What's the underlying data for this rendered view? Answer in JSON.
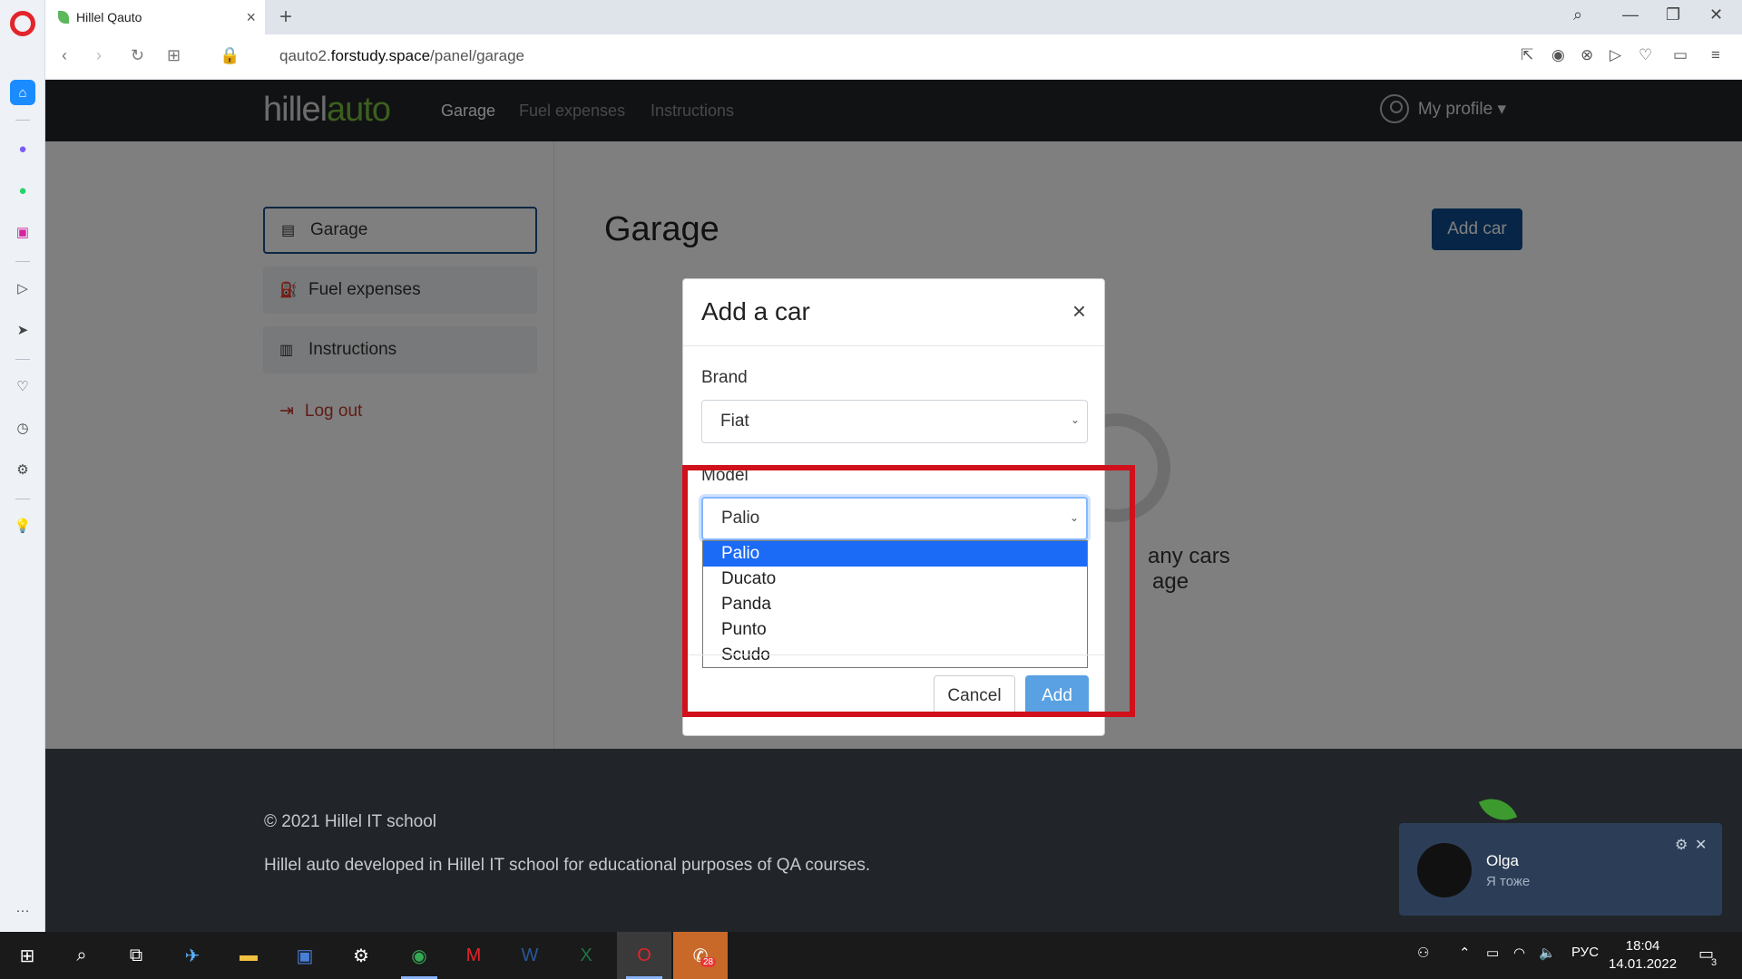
{
  "browser": {
    "tab_title": "Hillel Qauto",
    "new_tab": "+",
    "url_prefix": "qauto2.",
    "url_domain": "forstudy.space",
    "url_path": "/panel/garage"
  },
  "site": {
    "logo_part1": "hillel",
    "logo_part2": "auto",
    "nav": [
      "Garage",
      "Fuel expenses",
      "Instructions"
    ],
    "profile_label": "My profile ▾"
  },
  "sidebar": {
    "items": [
      {
        "label": "Garage"
      },
      {
        "label": "Fuel expenses"
      },
      {
        "label": "Instructions"
      }
    ],
    "logout": "Log out"
  },
  "main": {
    "title": "Garage",
    "add_car": "Add car",
    "empty_line1": "any cars",
    "empty_line2": "age"
  },
  "modal": {
    "title": "Add a car",
    "close": "×",
    "brand_label": "Brand",
    "brand_value": "Fiat",
    "model_label": "Model",
    "model_value": "Palio",
    "model_options": [
      "Palio",
      "Ducato",
      "Panda",
      "Punto",
      "Scudo"
    ],
    "cancel": "Cancel",
    "add": "Add"
  },
  "footer": {
    "copyright": "© 2021 Hillel IT school",
    "about": "Hillel auto developed in Hillel IT school for educational purposes of QA courses."
  },
  "notification": {
    "name": "Olga",
    "message": "Я тоже"
  },
  "taskbar": {
    "lang": "РУС",
    "time": "18:04",
    "date": "14.01.2022",
    "notif_count": "3",
    "viber_badge": "28"
  },
  "colors": {
    "accent_blue": "#0f4c8f",
    "highlight_red": "#d0111b",
    "logo_green": "#7abe3c"
  }
}
